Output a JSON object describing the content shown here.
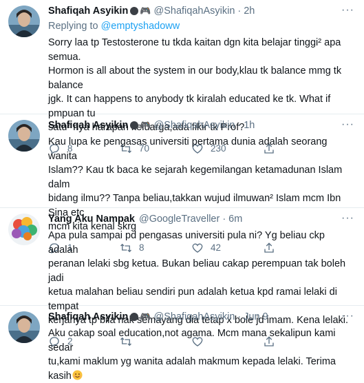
{
  "tweets": [
    {
      "name": "Shafiqah Asyikin",
      "handle": "@ShafiqahAsyikin",
      "time": "2h",
      "replying_prefix": "Replying to",
      "replying_to": "@emptyshadoww",
      "text": "Sorry laa tp Testosterone tu tkda kaitan dgn kita belajar tinggi² apa semua.\nHormon is all about the system in our body,klau tk balance mmg tk balance\njgk. It can happens to anybody tk kiralah educated ke tk. What if pmpuan tu\nsatu² nya harapan keluarga,ada fikir tk Prof?",
      "replies": "8",
      "retweets": "70",
      "likes": "230",
      "avatar": "person-photo"
    },
    {
      "name": "Shafiqah Asyikin",
      "handle": "@ShafiqahAsyikin",
      "time": "1h",
      "text": "Kau lupa ke pengasas universiti pertama dunia adalah seorang wanita\nIslam?? Kau tk baca ke sejarah kegemilangan ketamadunan Islam dalm\nbidang ilmu?? Tanpa beliau,takkan wujud ilmuwan² Islam mcm Ibn Sina etc\nmcm kita kenal skrg",
      "replies": "1",
      "retweets": "8",
      "likes": "42",
      "avatar": "person-photo"
    },
    {
      "name": "Yang Aku Nampak",
      "handle": "@GoogleTraveller",
      "time": "6m",
      "text": "Apa pula sampai pd pengasas universiti pula ni? Yg beliau ckp adalah\nperanan lelaki sbg ketua. Bukan beliau cakap perempuan tak boleh jadi\nketua malahan beliau sendiri pun adalah ketua kpd ramai lelaki di tempat\nkerjanya tp bila nak semayang dia tetap x bole jd imam. Kena lelaki.",
      "replies": "2",
      "retweets": "",
      "likes": "",
      "avatar": "colorful-brain"
    },
    {
      "name": "Shafiqah Asyikin",
      "handle": "@ShafiqahAsyikin",
      "time": "Jun 9",
      "text": "Aku cakap soal education,not agama. Mcm mana sekalipun kami sedar\ntu,kami maklum yg wanita adalah makmum kepada lelaki. Terima kasih",
      "replies": "",
      "retweets": "",
      "likes": "",
      "avatar": "person-photo"
    }
  ],
  "icons": {
    "more": "more-horizontal-icon",
    "reply": "reply-icon",
    "retweet": "retweet-icon",
    "like": "heart-icon",
    "share": "share-icon",
    "emoji_status": "dark-circle-icon",
    "gamepad": "gamepad-icon",
    "smile": "smiling-face-emoji"
  },
  "colors": {
    "link": "#1da1f2",
    "secondary": "#5b7083",
    "divider": "#e6ecf0"
  }
}
